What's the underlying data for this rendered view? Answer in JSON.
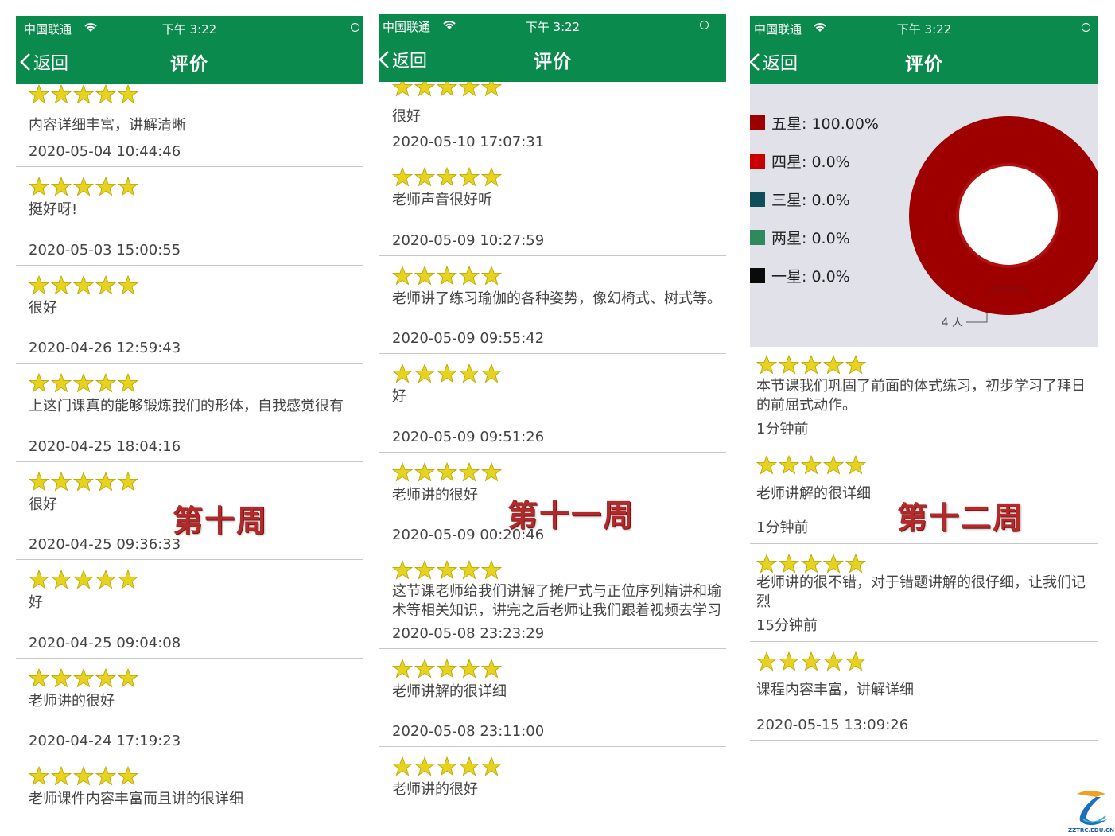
{
  "status_bar": {
    "carrier": "中国联通",
    "time": "下午 3:22"
  },
  "nav": {
    "back_label": "返回",
    "title": "评价"
  },
  "week_labels": {
    "p1": "第十周",
    "p2": "第十一周",
    "p3": "第十二周"
  },
  "colors": {
    "header": "#0a8a4c",
    "star": "#e6d21f",
    "donut": "#a00000",
    "chart_bg": "#e1e1ea",
    "week_label": "#b22a2a"
  },
  "panel1": {
    "top_partial": {
      "text": "内容详细丰富，讲解清晰",
      "date": "2020-05-04 10:44:46"
    },
    "reviews": [
      {
        "stars": 5,
        "text": "挺好呀!",
        "date": "2020-05-03 15:00:55"
      },
      {
        "stars": 5,
        "text": "很好",
        "date": "2020-04-26 12:59:43"
      },
      {
        "stars": 5,
        "text": "上这门课真的能够锻炼我们的形体，自我感觉很有",
        "date": "2020-04-25 18:04:16"
      },
      {
        "stars": 5,
        "text": "很好",
        "date": "2020-04-25 09:36:33"
      },
      {
        "stars": 5,
        "text": "好",
        "date": "2020-04-25 09:04:08"
      },
      {
        "stars": 5,
        "text": "老师讲的很好",
        "date": "2020-04-24 17:19:23"
      },
      {
        "stars": 5,
        "text": "老师课件内容丰富而且讲的很详细",
        "date": ""
      }
    ]
  },
  "panel2": {
    "top_partial": {
      "text": "很好",
      "date": "2020-05-10 17:07:31"
    },
    "reviews": [
      {
        "stars": 5,
        "text": "老师声音很好听",
        "date": "2020-05-09 10:27:59"
      },
      {
        "stars": 5,
        "text": "老师讲了练习瑜伽的各种姿势，像幻椅式、树式等。",
        "date": "2020-05-09 09:55:42"
      },
      {
        "stars": 5,
        "text": "好",
        "date": "2020-05-09 09:51:26"
      },
      {
        "stars": 5,
        "text": "老师讲的很好",
        "date": "2020-05-09 00:20:46"
      },
      {
        "stars": 5,
        "text": "这节课老师给我们讲解了摊尸式与正位序列精讲和瑜\n术等相关知识，讲完之后老师让我们跟着视频去学习",
        "date": "2020-05-08 23:23:29"
      },
      {
        "stars": 5,
        "text": "老师讲解的很详细",
        "date": "2020-05-08 23:11:00"
      },
      {
        "stars": 5,
        "text": "老师讲的很好",
        "date": ""
      }
    ]
  },
  "panel3": {
    "chart_data": {
      "type": "pie",
      "categories": [
        "五星",
        "四星",
        "三星",
        "两星",
        "一星"
      ],
      "values": [
        100.0,
        0.0,
        0.0,
        0.0,
        0.0
      ],
      "legend_labels": [
        "五星: 100.00%",
        "四星: 0.0%",
        "三星: 0.0%",
        "两星: 0.0%",
        "一星: 0.0%"
      ],
      "colors": [
        "#9e0000",
        "#c80000",
        "#0e4e5a",
        "#2e8a5c",
        "#0a0a0a"
      ],
      "slice_label": "100.00%",
      "count_label": "4 人",
      "legend_position": "left"
    },
    "reviews": [
      {
        "stars": 5,
        "text": "本节课我们巩固了前面的体式练习，初步学习了拜日\n的前屈式动作。",
        "date": "1分钟前"
      },
      {
        "stars": 5,
        "text": "老师讲解的很详细",
        "date": "1分钟前"
      },
      {
        "stars": 5,
        "text": "老师讲的很不错，对于错题讲解的很仔细，让我们记\n烈",
        "date": "15分钟前"
      },
      {
        "stars": 5,
        "text": "课程内容丰富，讲解详细",
        "date": "2020-05-15 13:09:26"
      }
    ]
  },
  "logo": {
    "text": "ZZTRC.EDU.CN"
  }
}
